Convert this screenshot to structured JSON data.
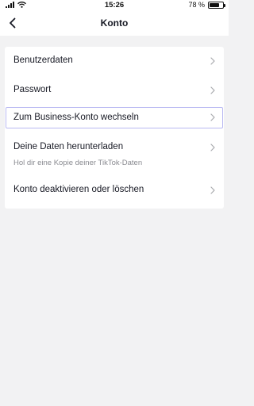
{
  "status_bar": {
    "time": "15:26",
    "battery_percent": "78 %",
    "battery_level": 0.78
  },
  "header": {
    "title": "Konto"
  },
  "menu": {
    "items": [
      {
        "label": "Benutzerdaten",
        "subtitle": ""
      },
      {
        "label": "Passwort",
        "subtitle": ""
      },
      {
        "label": "Zum Business-Konto wechseln",
        "subtitle": ""
      },
      {
        "label": "Deine Daten herunterladen",
        "subtitle": "Hol dir eine Kopie deiner TikTok-Daten"
      },
      {
        "label": "Konto deaktivieren oder löschen",
        "subtitle": ""
      }
    ]
  },
  "colors": {
    "background": "#f2f2f3",
    "card": "#ffffff",
    "text": "#161823",
    "secondary_text": "#8a8b91",
    "chevron": "#a8a9ad",
    "focus_outline": "#b9b9f2"
  },
  "icons": {
    "back": "chevron-left-icon",
    "row_arrow": "chevron-right-icon",
    "wifi": "wifi-icon",
    "signal": "signal-icon",
    "battery": "battery-icon"
  }
}
